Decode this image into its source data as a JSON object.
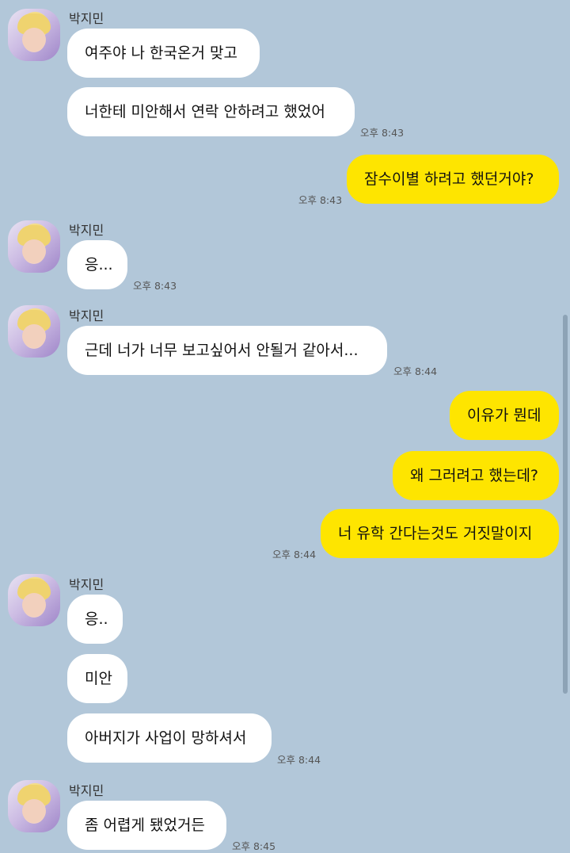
{
  "sender_name": "박지민",
  "messages": {
    "m1": "여주야 나 한국온거 맞고",
    "m2": "너한테 미안해서 연락 안하려고 했었어",
    "m3": "잠수이별 하려고 했던거야?",
    "m4": "응...",
    "m5": "근데 너가 너무 보고싶어서 안될거 같아서...",
    "m6": "이유가 뭔데",
    "m7": "왜 그러려고 했는데?",
    "m8": "너 유학 간다는것도 거짓말이지",
    "m9": "응..",
    "m10": "미안",
    "m11": "아버지가 사업이 망하셔서",
    "m12": "좀 어렵게 됐었거든"
  },
  "timestamps": {
    "t1": "오후 8:43",
    "t2": "오후 8:43",
    "t3": "오후 8:43",
    "t4": "오후 8:44",
    "t5": "오후 8:44",
    "t6": "오후 8:44",
    "t7": "오후 8:45"
  }
}
